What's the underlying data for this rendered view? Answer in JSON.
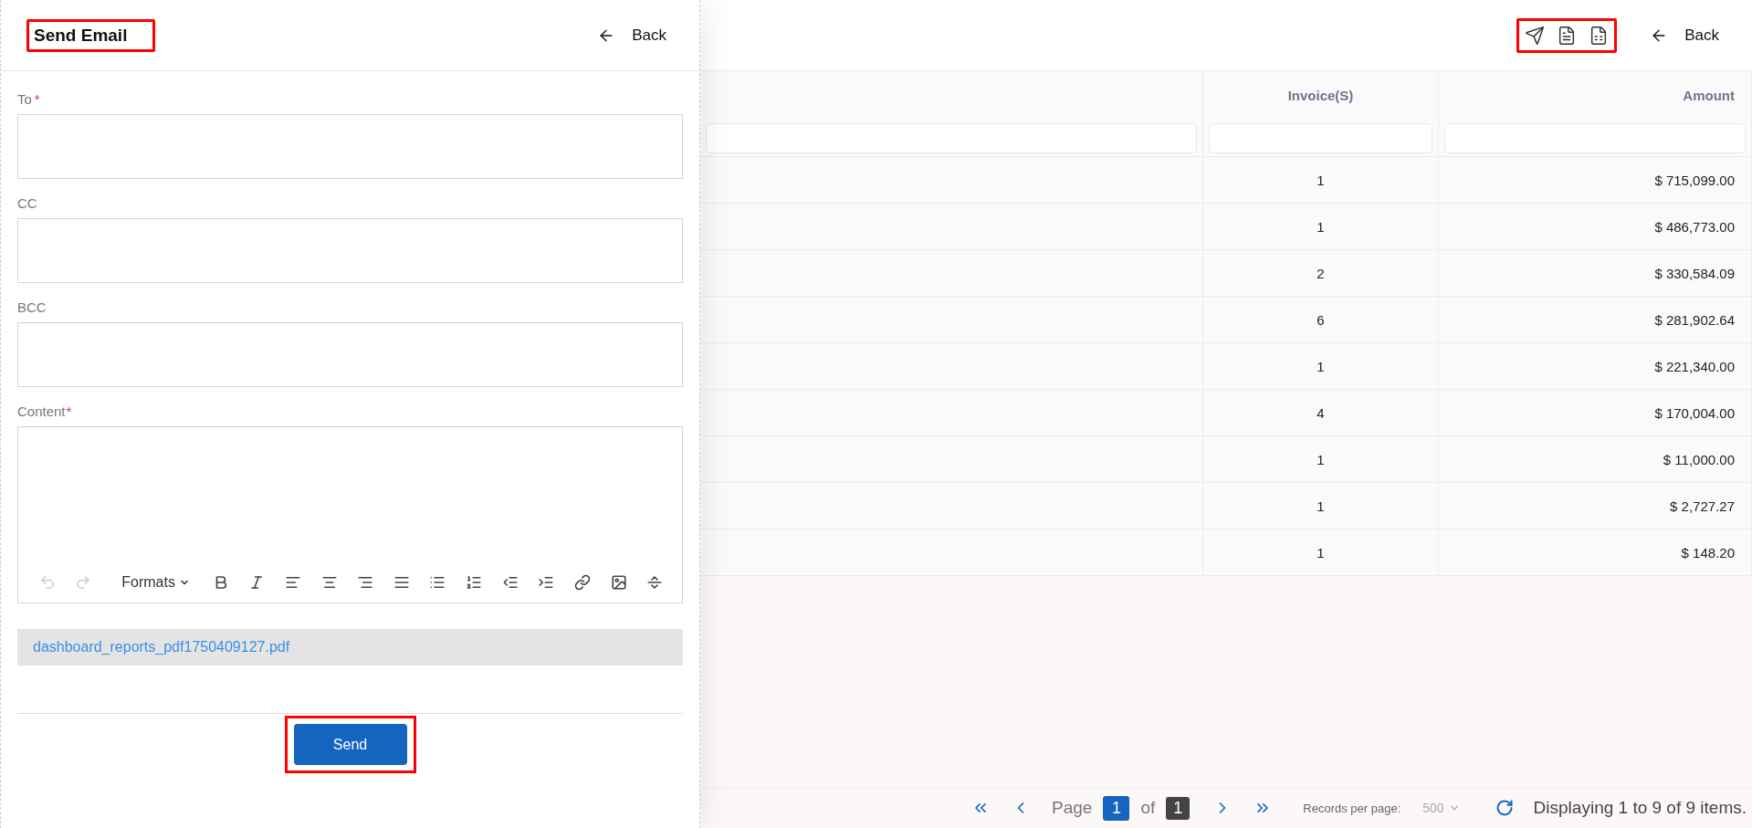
{
  "email_panel": {
    "title": "Send Email",
    "title_highlighted": true,
    "back_label": "Back",
    "fields": [
      {
        "label": "To",
        "required_mark": "*"
      },
      {
        "label": "CC"
      },
      {
        "label": "BCC"
      }
    ],
    "content": {
      "label": "Content",
      "required_mark": "*",
      "history_buttons": [
        {
          "disabled": true
        },
        {
          "disabled": true
        }
      ],
      "formats_label": "Formats"
    },
    "attachment": "dashboard_reports_pdf1750409127.pdf",
    "send_label": "Send",
    "send_highlighted": true
  },
  "report": {
    "export_icons_highlighted": true,
    "back_label": "Back",
    "table": {
      "columns": [
        "Invoice(S)",
        "Amount"
      ],
      "rows": [
        [
          "1",
          "$ 715,099.00"
        ],
        [
          "1",
          "$ 486,773.00"
        ],
        [
          "2",
          "$ 330,584.09"
        ],
        [
          "6",
          "$ 281,902.64"
        ],
        [
          "1",
          "$ 221,340.00"
        ],
        [
          "4",
          "$ 170,004.00"
        ],
        [
          "1",
          "$ 11,000.00"
        ],
        [
          "1",
          "$ 2,727.27"
        ],
        [
          "1",
          "$ 148.20"
        ]
      ]
    },
    "pagination": {
      "page_label": "Page",
      "page": "1",
      "of_label": "of",
      "total_pages": "1",
      "records_label": "Records per page:",
      "records_per_page": "500",
      "summary": "Displaying 1 to 9 of 9 items."
    }
  }
}
